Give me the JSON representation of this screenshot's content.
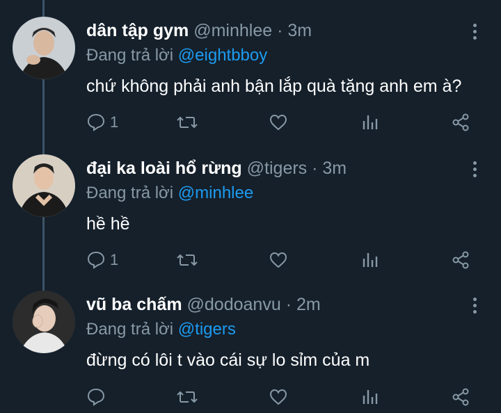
{
  "colors": {
    "background": "#15202b",
    "muted": "#8899a6",
    "accent": "#1d9bf0",
    "text": "#ffffff"
  },
  "tweets": [
    {
      "name": "dân tập gym",
      "handle": "@minhlee",
      "sep": "·",
      "time": "3m",
      "reply_prefix": "Đang trả lời",
      "reply_to": "@eightbboy",
      "text": "chứ không phải anh bận lắp quà tặng anh em à?",
      "reply_count": "1"
    },
    {
      "name": "đại ka loài hổ rừng",
      "handle": "@tigers",
      "sep": "·",
      "time": "3m",
      "reply_prefix": "Đang trả lời",
      "reply_to": "@minhlee",
      "text": "hề hề",
      "reply_count": "1"
    },
    {
      "name": "vũ ba chấm",
      "handle": "@dodoanvu",
      "sep": "·",
      "time": "2m",
      "reply_prefix": "Đang trả lời",
      "reply_to": "@tigers",
      "text": "đừng có lôi t vào cái sự lo sỉm của m",
      "reply_count": ""
    }
  ]
}
